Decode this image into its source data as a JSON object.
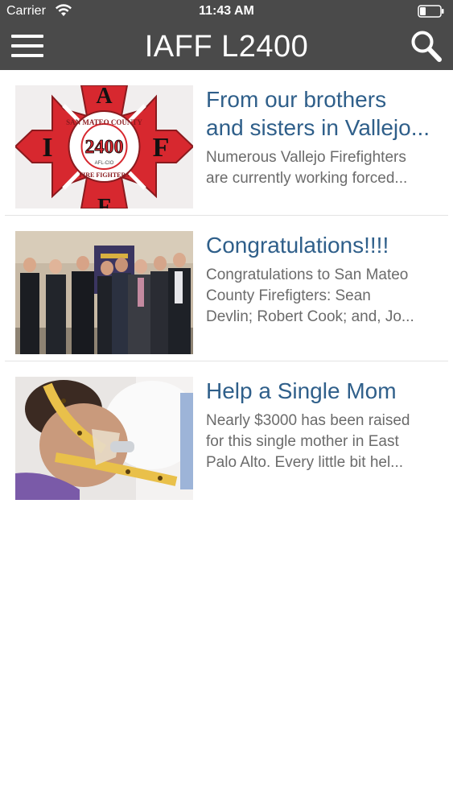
{
  "status_bar": {
    "carrier": "Carrier",
    "time": "11:43 AM"
  },
  "nav": {
    "title": "IAFF L2400",
    "menu_icon": "hamburger-menu-icon",
    "search_icon": "search-icon"
  },
  "articles": [
    {
      "headline_line1": "From our brothers",
      "headline_line2": "and sisters in Vallejo...",
      "summary_line1": "Numerous Vallejo Firefighters",
      "summary_line2": "are currently working forced...",
      "logo_top": "A",
      "logo_left": "I",
      "logo_right": "F",
      "logo_number": "2400",
      "logo_ring_top": "SAN MATEO COUNTY",
      "logo_ring_bottom": "FIRE FIGHTERS",
      "logo_small": "AFL-CIO"
    },
    {
      "headline_line1": "Congratulations!!!!",
      "summary_line1": "Congratulations to San Mateo",
      "summary_line2": "County Firefigters: Sean",
      "summary_line3": "Devlin; Robert Cook; and, Jo..."
    },
    {
      "headline_line1": "Help a Single Mom",
      "summary_line1": "Nearly $3000 has been raised",
      "summary_line2": "for this single mother in East",
      "summary_line3": "Palo Alto. Every little bit hel..."
    }
  ],
  "colors": {
    "nav_bg": "#4a4a4a",
    "headline": "#2f5f8a",
    "summary": "#6b6b6b",
    "logo_red": "#d7282f"
  }
}
